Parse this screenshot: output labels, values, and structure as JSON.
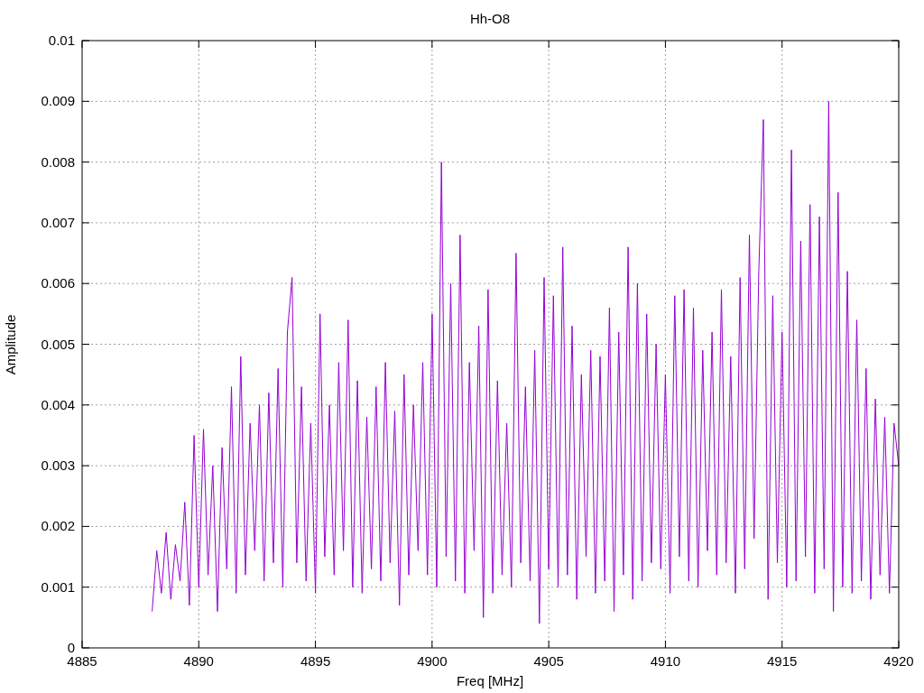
{
  "chart": {
    "chart_data": {
      "type": "line",
      "title": "Hh-O8",
      "xlabel": "Freq [MHz]",
      "ylabel": "Amplitude",
      "xlim": [
        4885,
        4920
      ],
      "ylim": [
        0,
        0.01
      ],
      "grid": true,
      "xticks": [
        4885,
        4890,
        4895,
        4900,
        4905,
        4910,
        4915,
        4920
      ],
      "yticks": [
        0.01,
        0.009,
        0.008,
        0.007,
        0.006,
        0.005,
        0.004,
        0.003,
        0.002,
        0.001,
        0
      ],
      "x": [
        4888,
        4888.2,
        4888.4,
        4888.6,
        4888.8,
        4889,
        4889.2,
        4889.4,
        4889.6,
        4889.8,
        4890,
        4890.2,
        4890.4,
        4890.6,
        4890.8,
        4891,
        4891.2,
        4891.4,
        4891.6,
        4891.8,
        4892,
        4892.2,
        4892.4,
        4892.6,
        4892.8,
        4893,
        4893.2,
        4893.4,
        4893.6,
        4893.8,
        4894,
        4894.2,
        4894.4,
        4894.6,
        4894.8,
        4895,
        4895.2,
        4895.4,
        4895.6,
        4895.8,
        4896,
        4896.2,
        4896.4,
        4896.6,
        4896.8,
        4897,
        4897.2,
        4897.4,
        4897.6,
        4897.8,
        4898,
        4898.2,
        4898.4,
        4898.6,
        4898.8,
        4899,
        4899.2,
        4899.4,
        4899.6,
        4899.8,
        4900,
        4900.2,
        4900.4,
        4900.6,
        4900.8,
        4901,
        4901.2,
        4901.4,
        4901.6,
        4901.8,
        4902,
        4902.2,
        4902.4,
        4902.6,
        4902.8,
        4903,
        4903.2,
        4903.4,
        4903.6,
        4903.8,
        4904,
        4904.2,
        4904.4,
        4904.6,
        4904.8,
        4905,
        4905.2,
        4905.4,
        4905.6,
        4905.8,
        4906,
        4906.2,
        4906.4,
        4906.6,
        4906.8,
        4907,
        4907.2,
        4907.4,
        4907.6,
        4907.8,
        4908,
        4908.2,
        4908.4,
        4908.6,
        4908.8,
        4909,
        4909.2,
        4909.4,
        4909.6,
        4909.8,
        4910,
        4910.2,
        4910.4,
        4910.6,
        4910.8,
        4911,
        4911.2,
        4911.4,
        4911.6,
        4911.8,
        4912,
        4912.2,
        4912.4,
        4912.6,
        4912.8,
        4913,
        4913.2,
        4913.4,
        4913.6,
        4913.8,
        4914,
        4914.2,
        4914.4,
        4914.6,
        4914.8,
        4915,
        4915.2,
        4915.4,
        4915.6,
        4915.8,
        4916,
        4916.2,
        4916.4,
        4916.6,
        4916.8,
        4917,
        4917.2,
        4917.4,
        4917.6,
        4917.8,
        4918,
        4918.2,
        4918.4,
        4918.6,
        4918.8,
        4919,
        4919.2,
        4919.4,
        4919.6,
        4919.8,
        4920
      ],
      "series": [
        {
          "color": "#9400d3",
          "values": [
            0.0006,
            0.0016,
            0.0009,
            0.0019,
            0.0008,
            0.0017,
            0.0011,
            0.0024,
            0.0007,
            0.0035,
            0.001,
            0.0036,
            0.0012,
            0.003,
            0.0006,
            0.0033,
            0.0013,
            0.0043,
            0.0009,
            0.0048,
            0.0012,
            0.0037,
            0.0016,
            0.004,
            0.0011,
            0.0042,
            0.0014,
            0.0046,
            0.001,
            0.0052,
            0.0061,
            0.0014,
            0.0043,
            0.0011,
            0.0037,
            0.0009,
            0.0055,
            0.0015,
            0.004,
            0.0012,
            0.0047,
            0.0016,
            0.0054,
            0.001,
            0.0044,
            0.0009,
            0.0038,
            0.0013,
            0.0043,
            0.0011,
            0.0047,
            0.0014,
            0.0039,
            0.0007,
            0.0045,
            0.0012,
            0.004,
            0.0016,
            0.0047,
            0.0012,
            0.0055,
            0.001,
            0.008,
            0.0015,
            0.006,
            0.0011,
            0.0068,
            0.0009,
            0.0047,
            0.0016,
            0.0053,
            0.0005,
            0.0059,
            0.0009,
            0.0044,
            0.0012,
            0.0037,
            0.001,
            0.0065,
            0.0014,
            0.0043,
            0.0011,
            0.0049,
            0.0004,
            0.0061,
            0.0013,
            0.0058,
            0.001,
            0.0066,
            0.0012,
            0.0053,
            0.0008,
            0.0045,
            0.0015,
            0.0049,
            0.0009,
            0.0048,
            0.0011,
            0.0056,
            0.0006,
            0.0052,
            0.0012,
            0.0066,
            0.0008,
            0.006,
            0.0011,
            0.0055,
            0.0014,
            0.005,
            0.0013,
            0.0045,
            0.0009,
            0.0058,
            0.0015,
            0.0059,
            0.0011,
            0.0056,
            0.001,
            0.0049,
            0.0016,
            0.0052,
            0.0012,
            0.0059,
            0.0014,
            0.0048,
            0.0009,
            0.0061,
            0.0013,
            0.0068,
            0.0018,
            0.0062,
            0.0087,
            0.0008,
            0.0058,
            0.0014,
            0.0052,
            0.001,
            0.0082,
            0.0011,
            0.0067,
            0.0015,
            0.0073,
            0.0009,
            0.0071,
            0.0013,
            0.009,
            0.0006,
            0.0075,
            0.001,
            0.0062,
            0.0009,
            0.0054,
            0.0011,
            0.0046,
            0.0008,
            0.0041,
            0.0012,
            0.0038,
            0.0009,
            0.0037,
            0.003
          ]
        }
      ]
    }
  }
}
